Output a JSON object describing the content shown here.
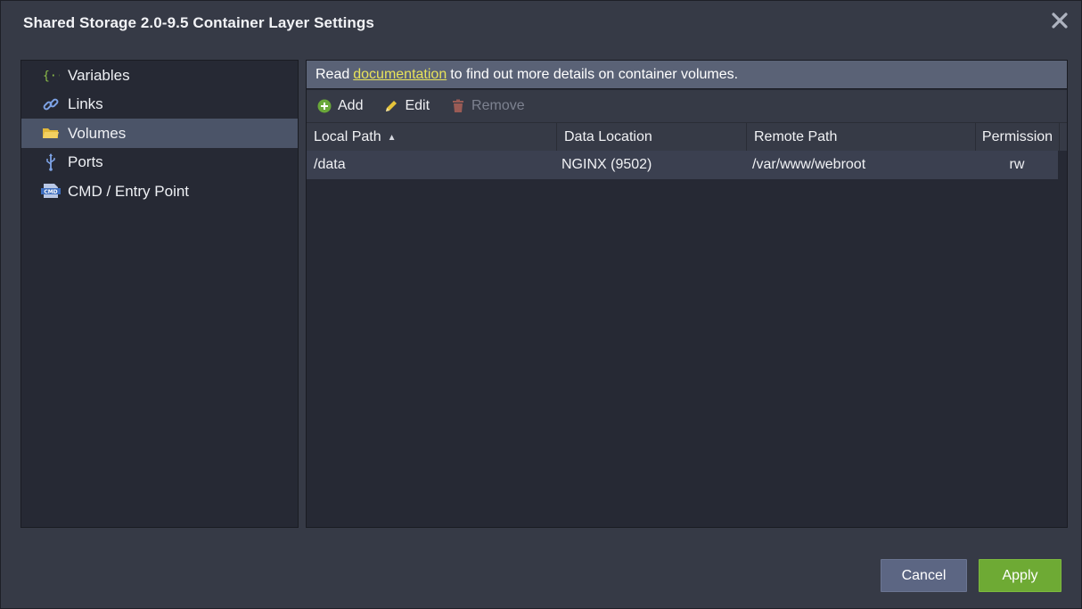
{
  "window": {
    "title": "Shared Storage 2.0-9.5 Container Layer Settings",
    "close_icon": "close-icon"
  },
  "sidebar": {
    "items": [
      {
        "label": "Variables",
        "icon": "braces-icon",
        "active": false
      },
      {
        "label": "Links",
        "icon": "link-icon",
        "active": false
      },
      {
        "label": "Volumes",
        "icon": "folder-icon",
        "active": true
      },
      {
        "label": "Ports",
        "icon": "usb-port-icon",
        "active": false
      },
      {
        "label": "CMD / Entry Point",
        "icon": "cmd-icon",
        "active": false
      }
    ]
  },
  "notice": {
    "prefix": "Read",
    "link": "documentation",
    "suffix": "to find out more details on container volumes."
  },
  "toolbar": {
    "add_label": "Add",
    "edit_label": "Edit",
    "remove_label": "Remove"
  },
  "table": {
    "columns": [
      "Local Path",
      "Data Location",
      "Remote Path",
      "Permission"
    ],
    "sorted_column": "Local Path",
    "sort_direction": "ascending",
    "rows": [
      {
        "local_path": "/data",
        "data_location": "NGINX (9502)",
        "remote_path": "/var/www/webroot",
        "permission": "rw"
      }
    ]
  },
  "footer": {
    "cancel_label": "Cancel",
    "apply_label": "Apply"
  },
  "colors": {
    "dialog_bg": "#363a46",
    "panel_bg": "#262934",
    "active_item": "#4b5468",
    "link": "#e8e35a",
    "apply": "#6eaa34",
    "cancel": "#5c6683"
  }
}
